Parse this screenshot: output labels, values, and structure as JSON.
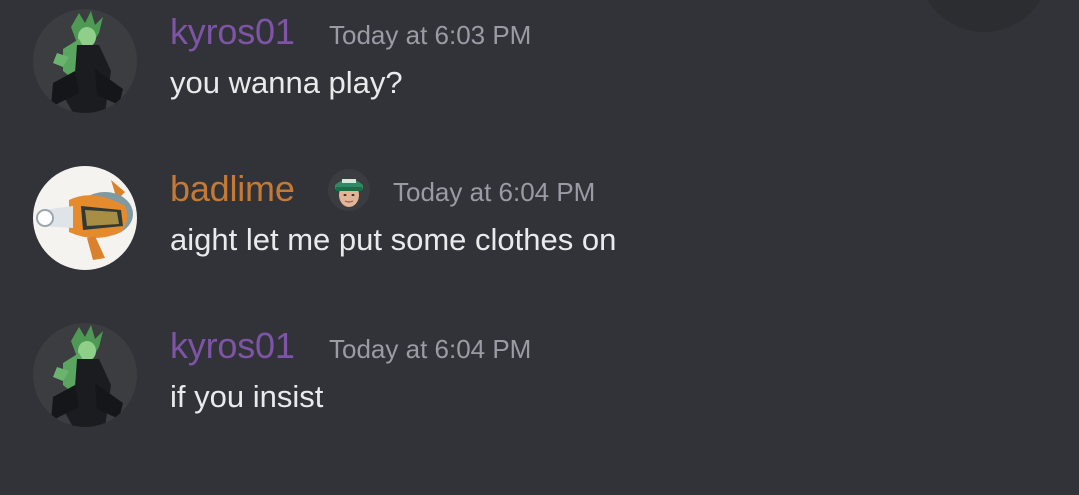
{
  "theme": {
    "background": "#313338",
    "text_color": "#eaeaec",
    "timestamp_color": "#9a9ca5"
  },
  "messages": [
    {
      "username": "kyros01",
      "username_color": "#7e54a6",
      "timestamp": "Today at 6:03 PM",
      "content": "you wanna play?",
      "avatar_icon": "green-haired-character-avatar-icon"
    },
    {
      "username": "badlime",
      "username_color": "#c47a35",
      "timestamp": "Today at 6:04 PM",
      "content": "aight let me put some clothes on",
      "avatar_icon": "koi-fish-avatar-icon",
      "badge_icon": "person-in-green-cap-emoji-icon"
    },
    {
      "username": "kyros01",
      "username_color": "#7e54a6",
      "timestamp": "Today at 6:04 PM",
      "content": "if you insist",
      "avatar_icon": "green-haired-character-avatar-icon"
    }
  ]
}
